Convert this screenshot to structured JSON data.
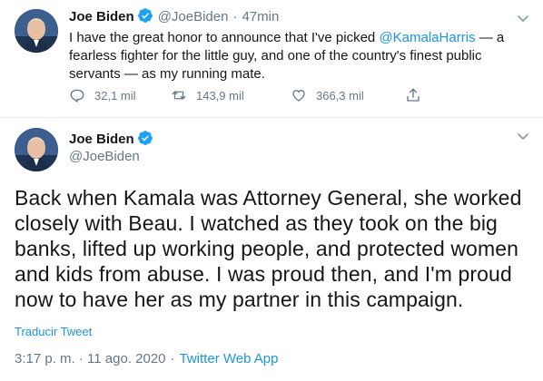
{
  "tweet1": {
    "author_name": "Joe Biden",
    "handle": "@JoeBiden",
    "separator": "·",
    "time": "47min",
    "text_before": "I have the great honor to announce that I've picked ",
    "mention": "@KamalaHarris",
    "text_after": " — a fearless fighter for the little guy, and one of the country's finest public servants — as my running mate.",
    "replies": "32,1 mil",
    "retweets": "143,9 mil",
    "likes": "366,3 mil"
  },
  "tweet2": {
    "author_name": "Joe Biden",
    "handle": "@JoeBiden",
    "text": "Back when Kamala was Attorney General, she worked closely with Beau. I watched as they took on the big banks, lifted up working people, and protected women and kids from abuse. I was proud then, and I'm proud now to have her as my partner in this campaign.",
    "translate_label": "Traducir Tweet",
    "timestamp": "3:17 p. m. · 11 ago. 2020",
    "meta_separator": "·",
    "source": "Twitter Web App"
  },
  "icons": {
    "verified_color": "#1da1f2",
    "action_color": "#657786",
    "link_color": "#1b95e0"
  }
}
